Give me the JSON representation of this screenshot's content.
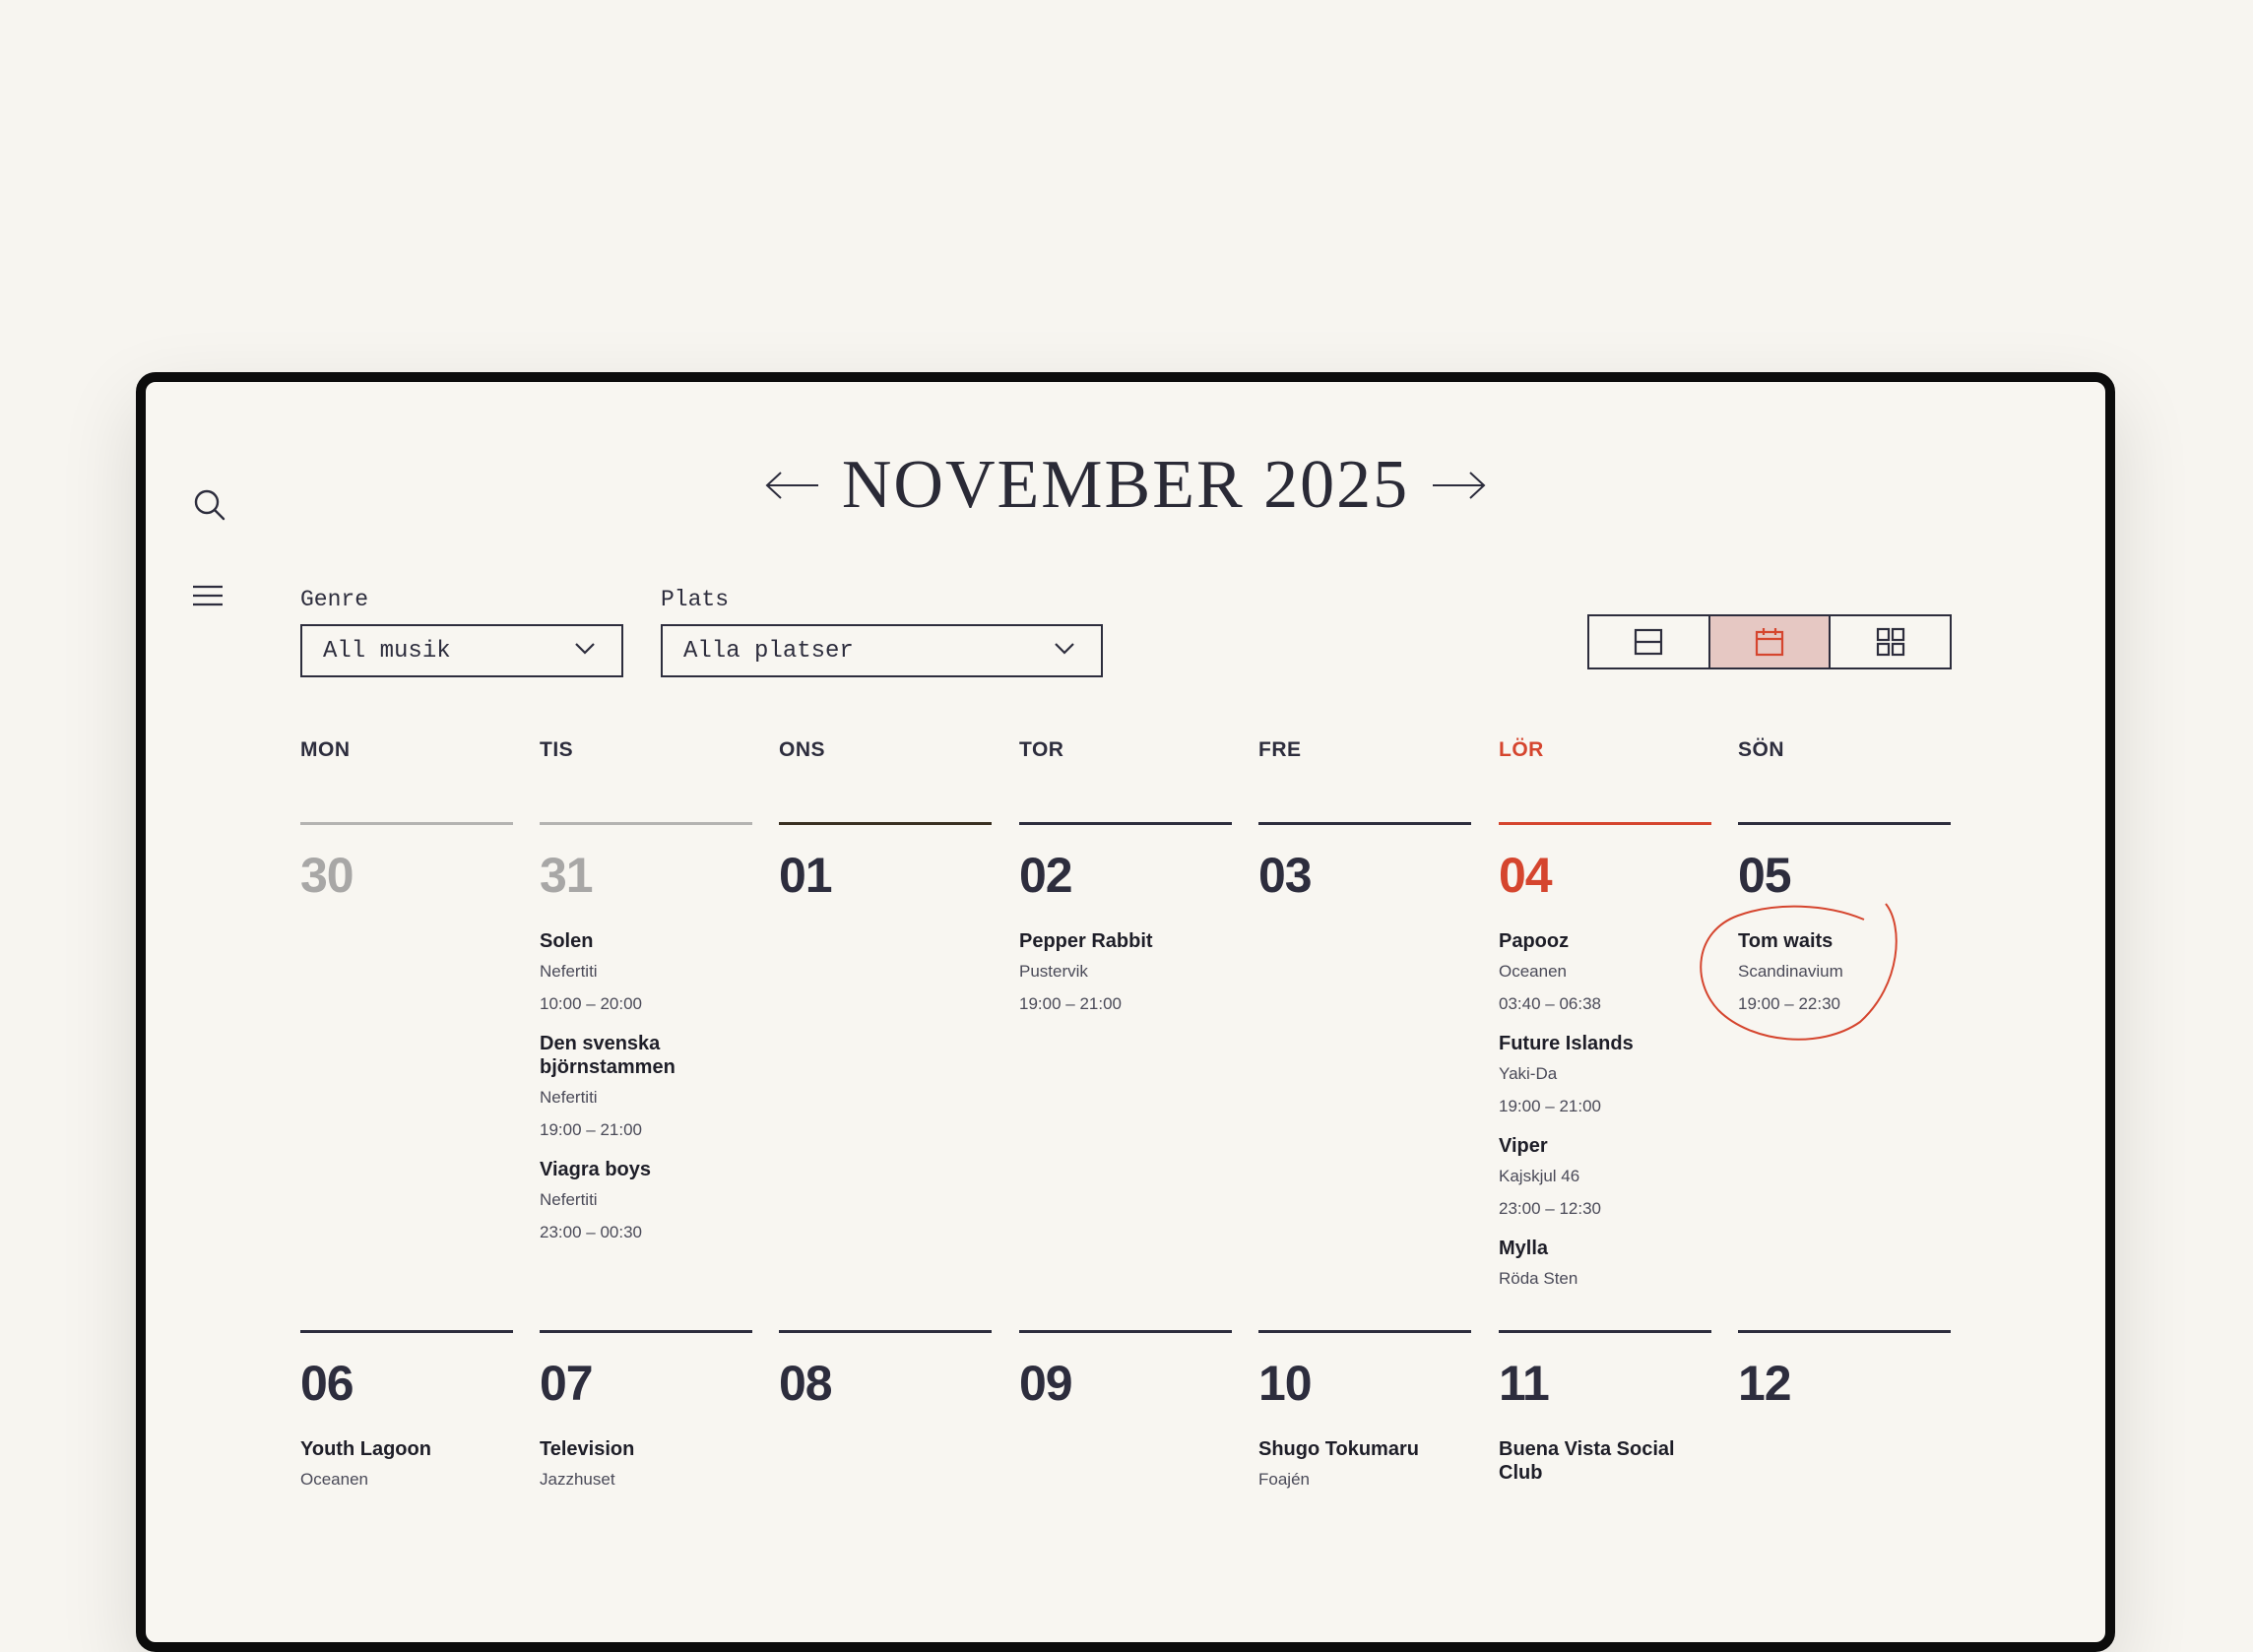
{
  "header": {
    "month_title": "NOVEMBER 2025"
  },
  "filters": {
    "genre": {
      "label": "Genre",
      "value": "All musik"
    },
    "place": {
      "label": "Plats",
      "value": "Alla platser"
    }
  },
  "view_toggle": {
    "active": "calendar"
  },
  "colors": {
    "accent": "#d5452e",
    "muted": "#a8a7a6",
    "ink": "#2d2d3d",
    "background": "#f7f5f0"
  },
  "weekdays": [
    "MON",
    "TIS",
    "ONS",
    "TOR",
    "FRE",
    "LÖR",
    "SÖN"
  ],
  "weeks": [
    {
      "days": [
        {
          "num": "30",
          "muted": true,
          "events": []
        },
        {
          "num": "31",
          "muted": true,
          "events": [
            {
              "name": "Solen",
              "venue": "Nefertiti",
              "time": "10:00 – 20:00"
            },
            {
              "name": "Den svenska björnstammen",
              "venue": "Nefertiti",
              "time": "19:00 – 21:00"
            },
            {
              "name": "Viagra boys",
              "venue": "Nefertiti",
              "time": "23:00 – 00:30"
            }
          ]
        },
        {
          "num": "01",
          "events": []
        },
        {
          "num": "02",
          "events": [
            {
              "name": "Pepper Rabbit",
              "venue": "Pustervik",
              "time": "19:00 – 21:00"
            }
          ]
        },
        {
          "num": "03",
          "events": []
        },
        {
          "num": "04",
          "accent": true,
          "events": [
            {
              "name": "Papooz",
              "venue": "Oceanen",
              "time": "03:40 – 06:38"
            },
            {
              "name": "Future Islands",
              "venue": "Yaki-Da",
              "time": "19:00 – 21:00"
            },
            {
              "name": "Viper",
              "venue": "Kajskjul 46",
              "time": "23:00 – 12:30"
            },
            {
              "name": "Mylla",
              "venue": "Röda Sten",
              "time": ""
            }
          ]
        },
        {
          "num": "05",
          "events": [
            {
              "name": "Tom waits",
              "venue": "Scandinavium",
              "time": "19:00 – 22:30"
            }
          ]
        }
      ]
    },
    {
      "days": [
        {
          "num": "06",
          "events": [
            {
              "name": "Youth Lagoon",
              "venue": "Oceanen",
              "time": ""
            }
          ]
        },
        {
          "num": "07",
          "events": [
            {
              "name": "Television",
              "venue": "Jazzhuset",
              "time": ""
            }
          ]
        },
        {
          "num": "08",
          "events": []
        },
        {
          "num": "09",
          "events": []
        },
        {
          "num": "10",
          "events": [
            {
              "name": "Shugo Tokumaru",
              "venue": "Foajén",
              "time": ""
            }
          ]
        },
        {
          "num": "11",
          "events": [
            {
              "name": "Buena Vista Social Club",
              "venue": "",
              "time": ""
            }
          ]
        },
        {
          "num": "12",
          "events": []
        }
      ]
    }
  ]
}
